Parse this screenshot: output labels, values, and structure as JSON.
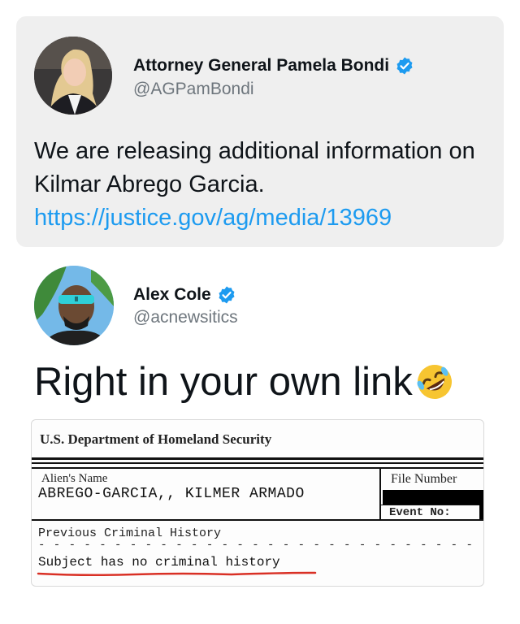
{
  "quoted_tweet": {
    "display_name": "Attorney General Pamela Bondi",
    "handle": "@AGPamBondi",
    "text": "We are releasing additional information on Kilmar Abrego Garcia.",
    "link": "https://justice.gov/ag/media/13969"
  },
  "tweet": {
    "display_name": "Alex Cole",
    "handle": "@acnewsitics",
    "text": "Right in your own link",
    "emoji": "rolling-on-floor-laughing"
  },
  "document": {
    "agency": "U.S. Department of Homeland Security",
    "alien_name_label": "Alien's Name",
    "alien_name_value": "ABREGO-GARCIA,, KILMER ARMADO",
    "file_number_label": "File Number",
    "event_no_label": "Event No:",
    "previous_history_label": "Previous Criminal History",
    "dashes": "- - - - - - - - - - - - - - - - - - - - - - - - - - - - -",
    "subject_text": "Subject has no criminal history",
    "underline_color": "#d93025"
  },
  "colors": {
    "link": "#1d9bf0",
    "verified": "#1d9bf0",
    "handle": "#6e767d",
    "card_background": "#efefef"
  }
}
